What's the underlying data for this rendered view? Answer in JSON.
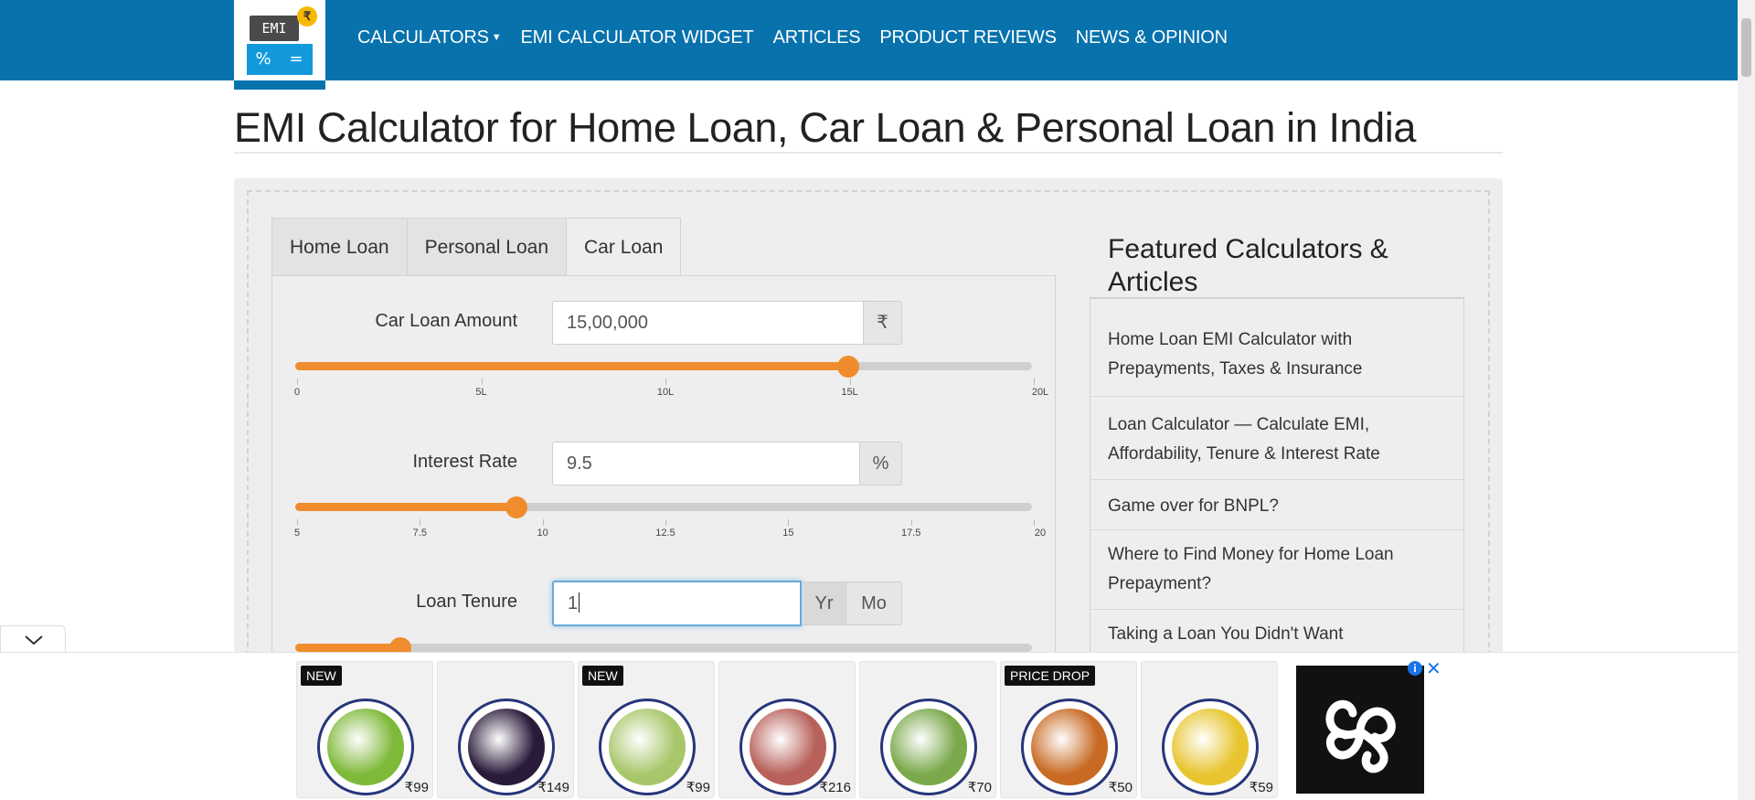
{
  "logo": {
    "screen_text": "EMI",
    "coin": "₹",
    "key1": "%",
    "key2": "="
  },
  "nav": {
    "items": [
      {
        "label": "CALCULATORS",
        "has_dropdown": true
      },
      {
        "label": "EMI CALCULATOR WIDGET"
      },
      {
        "label": "ARTICLES"
      },
      {
        "label": "PRODUCT REVIEWS"
      },
      {
        "label": "NEWS & OPINION"
      }
    ]
  },
  "page": {
    "title": "EMI Calculator for Home Loan, Car Loan & Personal Loan in India"
  },
  "tabs": [
    {
      "label": "Home Loan",
      "active": false
    },
    {
      "label": "Personal Loan",
      "active": false
    },
    {
      "label": "Car Loan",
      "active": true
    }
  ],
  "calculator": {
    "amount": {
      "label": "Car Loan Amount",
      "value": "15,00,000",
      "unit": "₹",
      "slider_fraction": 0.75,
      "ticks": [
        "0",
        "5L",
        "10L",
        "15L",
        "20L"
      ]
    },
    "interest": {
      "label": "Interest Rate",
      "value": "9.5",
      "unit": "%",
      "slider_fraction": 0.3,
      "ticks": [
        "5",
        "7.5",
        "10",
        "12.5",
        "15",
        "17.5",
        "20"
      ]
    },
    "tenure": {
      "label": "Loan Tenure",
      "value": "1",
      "unit_year": "Yr",
      "unit_month": "Mo",
      "slider_fraction": 0.143
    }
  },
  "sidebar": {
    "title": "Featured Calculators & Articles",
    "items": [
      "Home Loan EMI Calculator with Prepayments, Taxes & Insurance",
      "Loan Calculator — Calculate EMI, Affordability, Tenure & Interest Rate",
      "Game over for BNPL?",
      "Where to Find Money for Home Loan Prepayment?",
      "Taking a Loan You Didn't Want"
    ]
  },
  "ads": {
    "cards": [
      {
        "badge": "NEW",
        "price": "₹99",
        "color": "#7fb93a"
      },
      {
        "badge": "",
        "price": "₹149",
        "color": "#2a1a3a"
      },
      {
        "badge": "NEW",
        "price": "₹99",
        "color": "#a8c76a"
      },
      {
        "badge": "",
        "price": "₹216",
        "color": "#b8605a"
      },
      {
        "badge": "",
        "price": "₹70",
        "color": "#7aa84a"
      },
      {
        "badge": "PRICE DROP",
        "price": "₹50",
        "color": "#c86a24"
      },
      {
        "badge": "",
        "price": "₹59",
        "color": "#e8c530"
      }
    ],
    "info": "i",
    "close": "✕"
  }
}
